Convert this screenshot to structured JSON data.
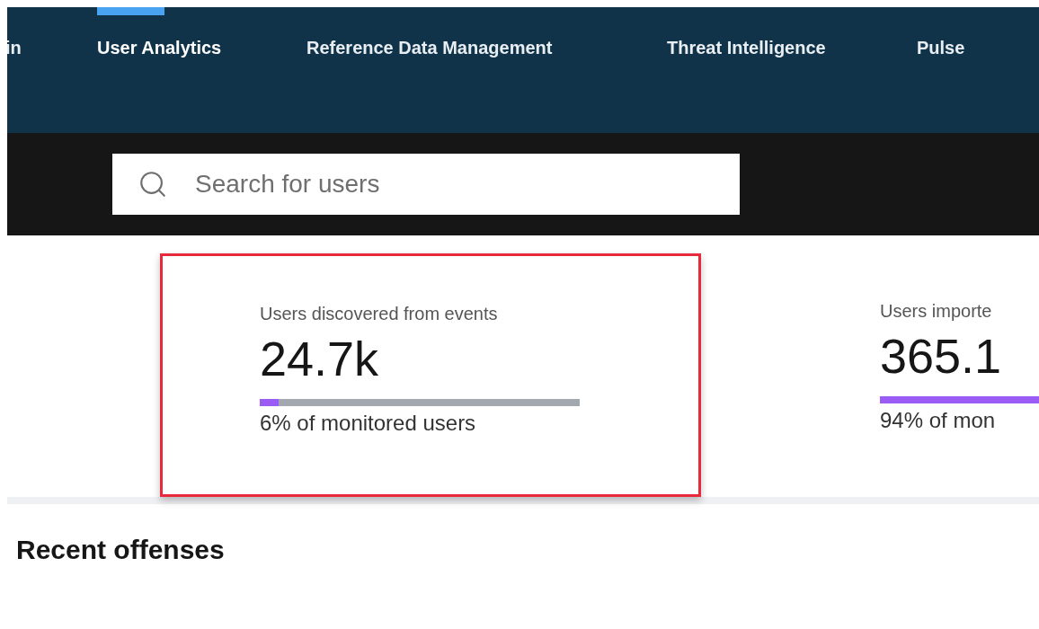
{
  "nav": {
    "tabs": [
      {
        "label": "in",
        "selected": false
      },
      {
        "label": "User Analytics",
        "selected": true
      },
      {
        "label": "Reference Data Management",
        "selected": false
      },
      {
        "label": "Threat Intelligence",
        "selected": false
      },
      {
        "label": "Pulse",
        "selected": false
      }
    ]
  },
  "search": {
    "placeholder": "Search for users"
  },
  "cards": [
    {
      "label": "Users discovered from events",
      "value": "24.7k",
      "level": 0.06,
      "caption": "6% of monitored users",
      "highlighted": true
    },
    {
      "label": "Users importe",
      "value": "365.1",
      "caption": "94% of mon",
      "highlighted": false
    }
  ],
  "section_title": "Recent offenses"
}
